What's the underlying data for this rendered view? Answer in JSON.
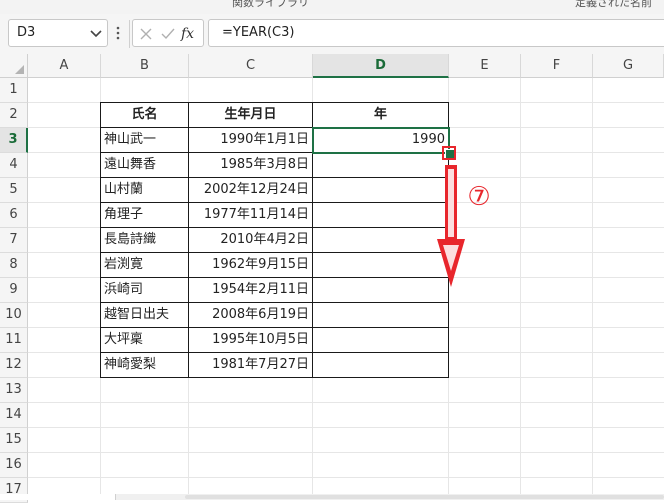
{
  "ribbon": {
    "left_label": "関数ライブラリ",
    "right_label": "定義された名前"
  },
  "name_box": {
    "value": "D3"
  },
  "formula_bar": {
    "value": "=YEAR(C3)",
    "fx_label": "fx"
  },
  "columns": [
    "A",
    "B",
    "C",
    "D",
    "E",
    "F",
    "G"
  ],
  "selected_column": "D",
  "rows": [
    "1",
    "2",
    "3",
    "4",
    "5",
    "6",
    "7",
    "8",
    "9",
    "10",
    "11",
    "12",
    "13",
    "14",
    "15",
    "16",
    "17"
  ],
  "selected_row": "3",
  "table": {
    "headers": [
      "氏名",
      "生年月日",
      "年"
    ],
    "rows": [
      {
        "name": "神山武一",
        "birthdate": "1990年1月1日",
        "year": "1990"
      },
      {
        "name": "遠山舞香",
        "birthdate": "1985年3月8日",
        "year": ""
      },
      {
        "name": "山村蘭",
        "birthdate": "2002年12月24日",
        "year": ""
      },
      {
        "name": "角理子",
        "birthdate": "1977年11月14日",
        "year": ""
      },
      {
        "name": "長島詩織",
        "birthdate": "2010年4月2日",
        "year": ""
      },
      {
        "name": "岩渕寛",
        "birthdate": "1962年9月15日",
        "year": ""
      },
      {
        "name": "浜崎司",
        "birthdate": "1954年2月11日",
        "year": ""
      },
      {
        "name": "越智日出夫",
        "birthdate": "2008年6月19日",
        "year": ""
      },
      {
        "name": "大坪稟",
        "birthdate": "1995年10月5日",
        "year": ""
      },
      {
        "name": "神崎愛梨",
        "birthdate": "1981年7月27日",
        "year": ""
      }
    ]
  },
  "annotation": {
    "step_label": "⑦",
    "color": "#e8262c"
  },
  "colors": {
    "accent": "#1e7145",
    "annotation": "#e8262c"
  }
}
